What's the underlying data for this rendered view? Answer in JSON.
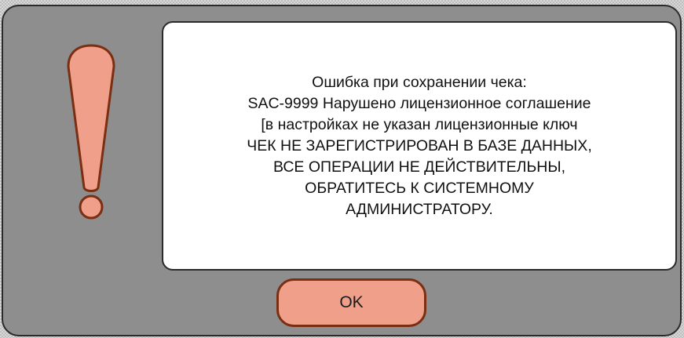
{
  "dialog": {
    "icon": "exclamation-icon",
    "message_lines": [
      "Ошибка при сохранении чека:",
      "SAC-9999 Нарушено лицензионное соглашение",
      "[в настройках не указан лицензионные ключ",
      "ЧЕК НЕ ЗАРЕГИСТРИРОВАН В БАЗЕ ДАННЫХ,",
      "ВСЕ ОПЕРАЦИИ НЕ ДЕЙСТВИТЕЛЬНЫ,",
      "ОБРАТИТЕСЬ К СИСТЕМНОМУ",
      "АДМИНИСТРАТОРУ."
    ],
    "ok_label": "OK"
  },
  "colors": {
    "dialog_background": "#8e8e8e",
    "icon_fill": "#f0a08a",
    "icon_stroke": "#7a2e12",
    "button_fill": "#f0a08a",
    "button_border": "#7a2e12"
  }
}
